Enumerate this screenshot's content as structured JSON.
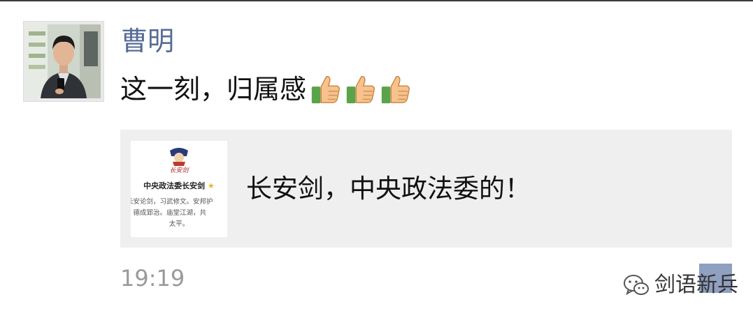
{
  "post": {
    "author": "曹明",
    "comment": "这一刻，归属感",
    "comment_emoji": [
      "thumbs-up-icon",
      "thumbs-up-icon",
      "thumbs-up-icon"
    ],
    "timestamp": "19:19"
  },
  "shared_link": {
    "title": "长安剑，中央政法委的！",
    "thumbnail": {
      "logo_text": "长安剑",
      "account_name": "中央政法委长安剑",
      "description_lines": [
        "长安论剑，习武修文。安邦护",
        "，德成郅治。庙堂江湖，共",
        "太平。"
      ]
    }
  },
  "watermark": {
    "text": "剑语新兵",
    "icon": "wechat-icon"
  },
  "colors": {
    "name_link": "#576b95",
    "card_bg": "#efefef",
    "timestamp": "#9a9a9a"
  }
}
